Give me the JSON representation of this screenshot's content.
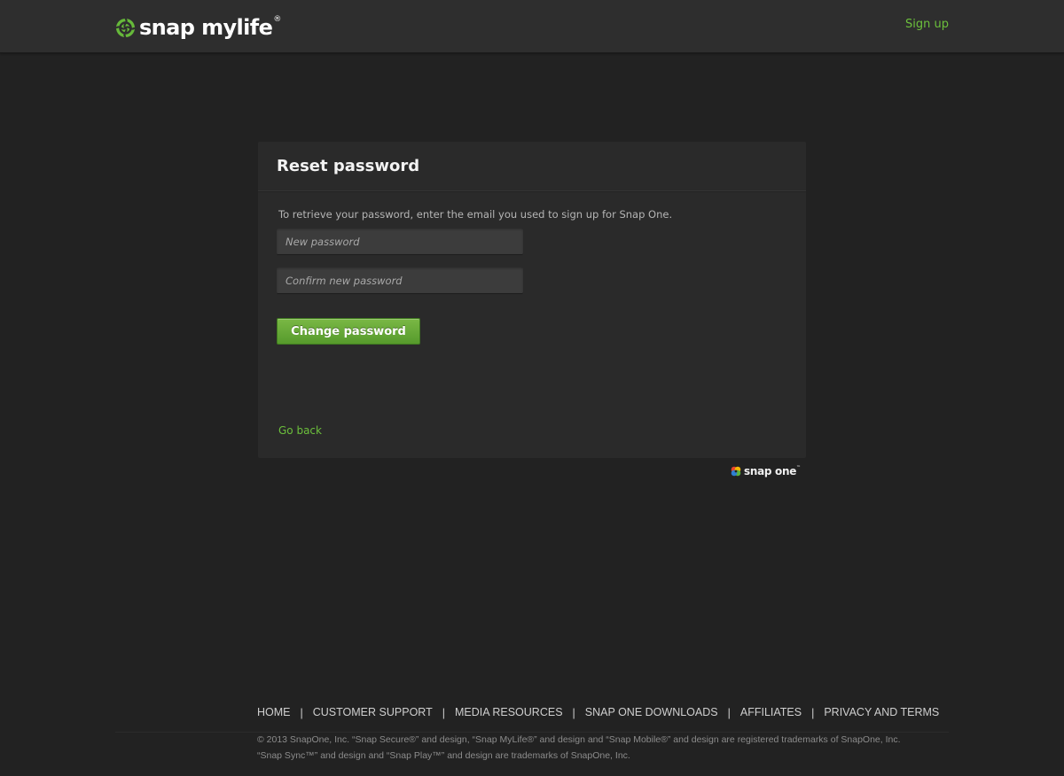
{
  "header": {
    "brand_text": "snap mylife",
    "brand_reg": "®",
    "signup_label": "Sign up"
  },
  "colors": {
    "accent_green": "#6cc03c",
    "button_green": "#6aab3b",
    "background": "#222222",
    "card": "#2a2a2a"
  },
  "card": {
    "title": "Reset password",
    "description": "To retrieve your password, enter the email you used to sign up for Snap One.",
    "new_password": {
      "value": "",
      "placeholder": "New password"
    },
    "confirm_password": {
      "value": "",
      "placeholder": "Confirm new password"
    },
    "submit_label": "Change password",
    "back_label": "Go back"
  },
  "partner": {
    "text": "snap one",
    "tm": "™"
  },
  "footer": {
    "links": [
      "HOME",
      "CUSTOMER SUPPORT",
      "MEDIA RESOURCES",
      "SNAP ONE DOWNLOADS",
      "AFFILIATES",
      "PRIVACY AND TERMS"
    ],
    "separator": "|",
    "legal_line1": "© 2013 SnapOne, Inc.  “Snap Secure®” and design, “Snap MyLife®” and design and “Snap Mobile®” and design are registered trademarks of SnapOne, Inc.",
    "legal_line2": "“Snap Sync™” and design and “Snap Play™” and design are trademarks of SnapOne, Inc."
  },
  "icons": {
    "brand_logo": "snap-mylife-logo-icon",
    "partner_logo": "snap-one-logo-icon"
  }
}
